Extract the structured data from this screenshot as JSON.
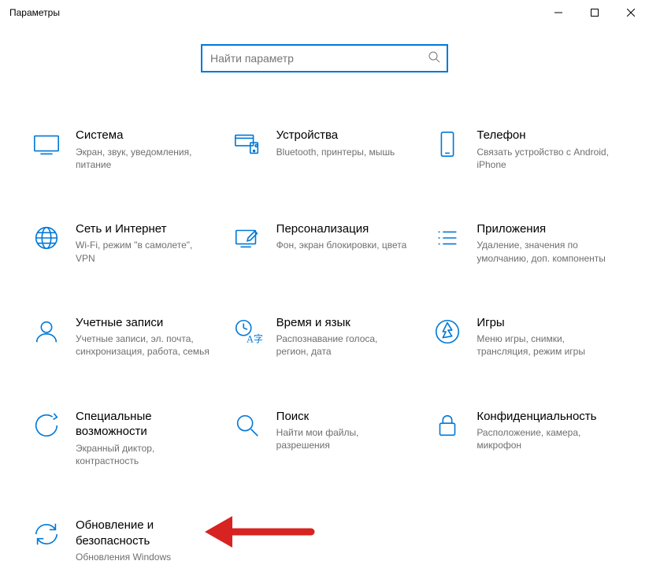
{
  "window": {
    "title": "Параметры"
  },
  "search": {
    "placeholder": "Найти параметр"
  },
  "tiles": [
    {
      "title": "Система",
      "desc": "Экран, звук, уведомления, питание"
    },
    {
      "title": "Устройства",
      "desc": "Bluetooth, принтеры, мышь"
    },
    {
      "title": "Телефон",
      "desc": "Связать устройство с Android, iPhone"
    },
    {
      "title": "Сеть и Интернет",
      "desc": "Wi-Fi, режим \"в самолете\", VPN"
    },
    {
      "title": "Персонализация",
      "desc": "Фон, экран блокировки, цвета"
    },
    {
      "title": "Приложения",
      "desc": "Удаление, значения по умолчанию, доп. компоненты"
    },
    {
      "title": "Учетные записи",
      "desc": "Учетные записи, эл. почта, синхронизация, работа, семья"
    },
    {
      "title": "Время и язык",
      "desc": "Распознавание голоса, регион, дата"
    },
    {
      "title": "Игры",
      "desc": "Меню игры, снимки, трансляция, режим игры"
    },
    {
      "title": "Специальные возможности",
      "desc": "Экранный диктор, контрастность"
    },
    {
      "title": "Поиск",
      "desc": "Найти мои файлы, разрешения"
    },
    {
      "title": "Конфиденциальность",
      "desc": "Расположение, камера, микрофон"
    },
    {
      "title": "Обновление и безопасность",
      "desc": "Обновления Windows"
    }
  ],
  "colors": {
    "accent": "#0078d7",
    "arrow": "#d72321"
  }
}
